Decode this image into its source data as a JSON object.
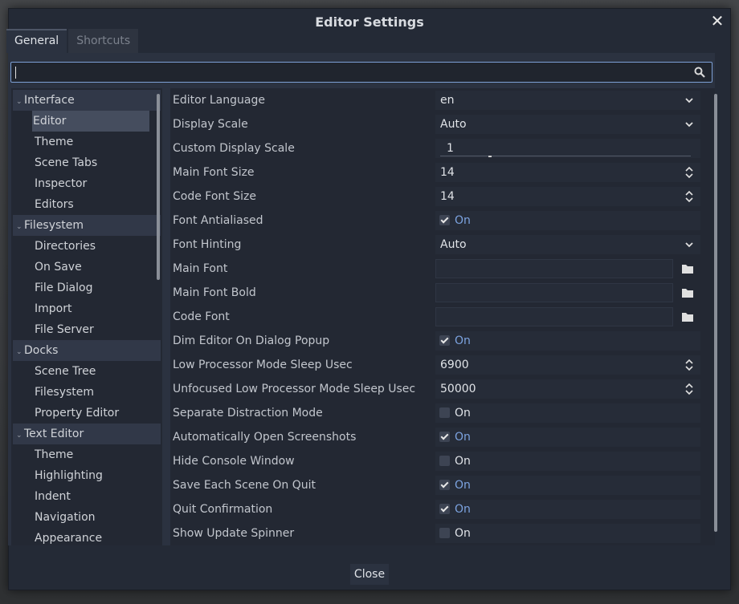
{
  "dialog": {
    "title": "Editor Settings",
    "close_glyph": "✕",
    "close_button_label": "Close"
  },
  "tabs": [
    {
      "label": "General",
      "active": true
    },
    {
      "label": "Shortcuts",
      "active": false
    }
  ],
  "search": {
    "value": "",
    "placeholder": ""
  },
  "tree": [
    {
      "label": "Interface",
      "type": "section"
    },
    {
      "label": "Editor",
      "type": "child",
      "selected": true
    },
    {
      "label": "Theme",
      "type": "child"
    },
    {
      "label": "Scene Tabs",
      "type": "child"
    },
    {
      "label": "Inspector",
      "type": "child"
    },
    {
      "label": "Editors",
      "type": "child"
    },
    {
      "label": "Filesystem",
      "type": "section"
    },
    {
      "label": "Directories",
      "type": "child"
    },
    {
      "label": "On Save",
      "type": "child"
    },
    {
      "label": "File Dialog",
      "type": "child"
    },
    {
      "label": "Import",
      "type": "child"
    },
    {
      "label": "File Server",
      "type": "child"
    },
    {
      "label": "Docks",
      "type": "section"
    },
    {
      "label": "Scene Tree",
      "type": "child"
    },
    {
      "label": "Filesystem",
      "type": "child"
    },
    {
      "label": "Property Editor",
      "type": "child"
    },
    {
      "label": "Text Editor",
      "type": "section"
    },
    {
      "label": "Theme",
      "type": "child"
    },
    {
      "label": "Highlighting",
      "type": "child"
    },
    {
      "label": "Indent",
      "type": "child"
    },
    {
      "label": "Navigation",
      "type": "child"
    },
    {
      "label": "Appearance",
      "type": "child"
    }
  ],
  "properties": [
    {
      "label": "Editor Language",
      "kind": "dropdown",
      "value": "en"
    },
    {
      "label": "Display Scale",
      "kind": "dropdown",
      "value": "Auto"
    },
    {
      "label": "Custom Display Scale",
      "kind": "slider",
      "value": "1"
    },
    {
      "label": "Main Font Size",
      "kind": "spin",
      "value": "14"
    },
    {
      "label": "Code Font Size",
      "kind": "spin",
      "value": "14"
    },
    {
      "label": "Font Antialiased",
      "kind": "check",
      "checked": true,
      "value": "On"
    },
    {
      "label": "Font Hinting",
      "kind": "dropdown",
      "value": "Auto"
    },
    {
      "label": "Main Font",
      "kind": "file",
      "value": ""
    },
    {
      "label": "Main Font Bold",
      "kind": "file",
      "value": ""
    },
    {
      "label": "Code Font",
      "kind": "file",
      "value": ""
    },
    {
      "label": "Dim Editor On Dialog Popup",
      "kind": "check",
      "checked": true,
      "value": "On"
    },
    {
      "label": "Low Processor Mode Sleep Usec",
      "kind": "spin",
      "value": "6900"
    },
    {
      "label": "Unfocused Low Processor Mode Sleep Usec",
      "kind": "spin",
      "value": "50000"
    },
    {
      "label": "Separate Distraction Mode",
      "kind": "check",
      "checked": false,
      "value": "On"
    },
    {
      "label": "Automatically Open Screenshots",
      "kind": "check",
      "checked": true,
      "value": "On"
    },
    {
      "label": "Hide Console Window",
      "kind": "check",
      "checked": false,
      "value": "On"
    },
    {
      "label": "Save Each Scene On Quit",
      "kind": "check",
      "checked": true,
      "value": "On"
    },
    {
      "label": "Quit Confirmation",
      "kind": "check",
      "checked": true,
      "value": "On"
    },
    {
      "label": "Show Update Spinner",
      "kind": "check",
      "checked": false,
      "value": "On"
    }
  ],
  "colors": {
    "accent": "#7ca3e0",
    "dialog_bg": "#242a36",
    "panel_bg": "#232833"
  }
}
